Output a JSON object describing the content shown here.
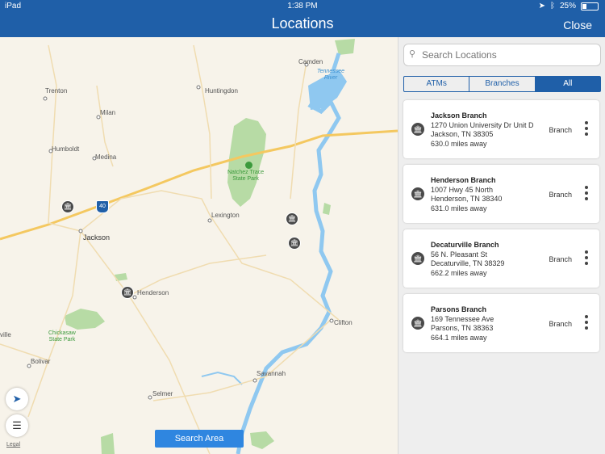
{
  "status_bar": {
    "device": "iPad",
    "time": "1:38 PM",
    "battery": "25%"
  },
  "nav": {
    "title": "Locations",
    "close_label": "Close"
  },
  "map": {
    "labels": {
      "camden": "Camden",
      "tennessee_river": "Tennessee\nRiver",
      "trenton": "Trenton",
      "huntingdon": "Huntingdon",
      "milan": "Milan",
      "humboldt": "Humboldt",
      "medina": "Medina",
      "natchez": "Natchez Trace\nState Park",
      "lexington": "Lexington",
      "jackson": "Jackson",
      "henderson": "Henderson",
      "chickasaw": "Chickasaw\nState Park",
      "ville": "ville",
      "clifton": "Clifton",
      "bolivar": "Bolivar",
      "savannah": "Savannah",
      "selmer": "Selmer",
      "interstate": "40"
    },
    "search_area_label": "Search Area",
    "legal_label": "Legal"
  },
  "search": {
    "placeholder": "Search Locations"
  },
  "filters": {
    "atms": "ATMs",
    "branches": "Branches",
    "all": "All"
  },
  "locations": [
    {
      "name": "Jackson Branch",
      "address1": "1270 Union University Dr Unit D",
      "address2": "Jackson, TN 38305",
      "distance": "630.0 miles away",
      "type": "Branch"
    },
    {
      "name": "Henderson Branch",
      "address1": "1007 Hwy 45 North",
      "address2": "Henderson, TN 38340",
      "distance": "631.0 miles away",
      "type": "Branch"
    },
    {
      "name": "Decaturville Branch",
      "address1": "56 N. Pleasant St",
      "address2": "Decaturville, TN 38329",
      "distance": "662.2 miles away",
      "type": "Branch"
    },
    {
      "name": "Parsons Branch",
      "address1": "169 Tennessee Ave",
      "address2": "Parsons, TN 38363",
      "distance": "664.1 miles away",
      "type": "Branch"
    }
  ]
}
